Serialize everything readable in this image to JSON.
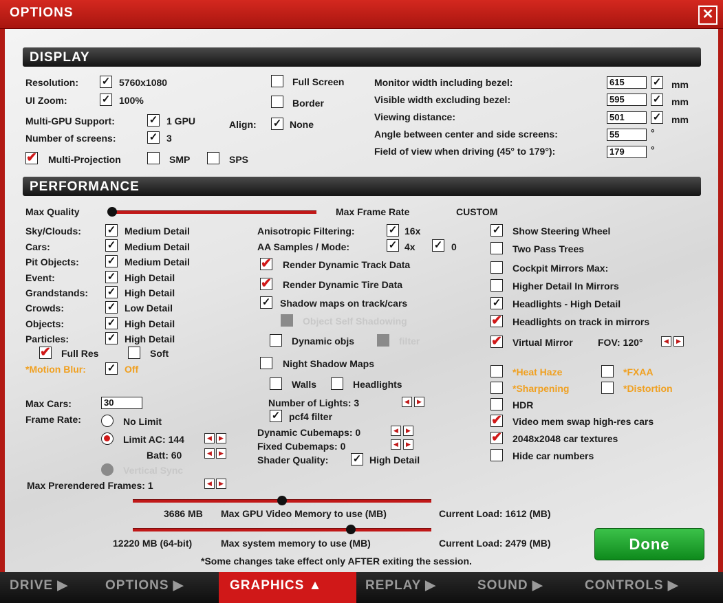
{
  "window": {
    "title": "OPTIONS",
    "close": "✕"
  },
  "display": {
    "header": "DISPLAY",
    "resolution_label": "Resolution:",
    "resolution_value": "5760x1080",
    "ui_zoom_label": "UI Zoom:",
    "ui_zoom_value": "100%",
    "multigpu_label": "Multi-GPU Support:",
    "multigpu_value": "1 GPU",
    "screens_label": "Number of screens:",
    "screens_value": "3",
    "multiprojection_label": "Multi-Projection",
    "smp_label": "SMP",
    "sps_label": "SPS",
    "fullscreen_label": "Full Screen",
    "border_label": "Border",
    "align_label": "Align:",
    "align_value": "None",
    "monitor_width_label": "Monitor width including bezel:",
    "monitor_width_value": "615",
    "visible_width_label": "Visible width excluding bezel:",
    "visible_width_value": "595",
    "viewing_distance_label": "Viewing distance:",
    "viewing_distance_value": "501",
    "unit_mm": "mm",
    "angle_label": "Angle between center and side screens:",
    "angle_value": "55",
    "fov_label": "Field of view when driving (45° to 179°):",
    "fov_value": "179",
    "degree": "°"
  },
  "performance": {
    "header": "PERFORMANCE",
    "max_quality_label": "Max Quality",
    "max_frame_rate_label": "Max Frame Rate",
    "preset_label": "CUSTOM",
    "quality_rows": [
      {
        "label": "Sky/Clouds:",
        "value": "Medium Detail"
      },
      {
        "label": "Cars:",
        "value": "Medium Detail"
      },
      {
        "label": "Pit Objects:",
        "value": "Medium Detail"
      },
      {
        "label": "Event:",
        "value": "High Detail"
      },
      {
        "label": "Grandstands:",
        "value": "High Detail"
      },
      {
        "label": "Crowds:",
        "value": "Low Detail"
      },
      {
        "label": "Objects:",
        "value": "High Detail"
      },
      {
        "label": "Particles:",
        "value": "High Detail"
      }
    ],
    "full_res_label": "Full Res",
    "soft_label": "Soft",
    "motion_blur_label": "*Motion Blur:",
    "motion_blur_value": "Off",
    "max_cars_label": "Max Cars:",
    "max_cars_value": "30",
    "frame_rate_label": "Frame Rate:",
    "no_limit_label": "No Limit",
    "limit_ac_label": "Limit AC: 144",
    "batt_label": "Batt: 60",
    "vsync_label": "Vertical Sync",
    "prerendered_label": "Max Prerendered Frames: 1",
    "aniso_label": "Anisotropic Filtering:",
    "aniso_value": "16x",
    "aa_label": "AA Samples / Mode:",
    "aa_value": "4x",
    "aa_mode": "0",
    "render_track_label": "Render Dynamic Track Data",
    "render_tire_label": "Render Dynamic Tire Data",
    "shadow_maps_label": "Shadow maps on track/cars",
    "self_shadow_label": "Object Self Shadowing",
    "dynamic_objs_label": "Dynamic objs",
    "filter_label": "filter",
    "night_shadow_label": "Night Shadow Maps",
    "walls_label": "Walls",
    "headlights_label": "Headlights",
    "num_lights_label": "Number of Lights: 3",
    "pcf4_label": "pcf4 filter",
    "dyn_cubemaps_label": "Dynamic Cubemaps: 0",
    "fixed_cubemaps_label": "Fixed Cubemaps: 0",
    "shader_quality_label": "Shader Quality:",
    "shader_quality_value": "High Detail",
    "show_wheel_label": "Show Steering Wheel",
    "two_pass_label": "Two Pass Trees",
    "cockpit_mirrors_label": "Cockpit Mirrors  Max:",
    "higher_detail_label": "Higher Detail In Mirrors",
    "headlights_hd_label": "Headlights - High Detail",
    "headlights_track_label": "Headlights on track in mirrors",
    "virtual_mirror_label": "Virtual Mirror",
    "fov_mirror_label": "FOV:  120°",
    "heat_haze_label": "*Heat Haze",
    "fxaa_label": "*FXAA",
    "sharpening_label": "*Sharpening",
    "distortion_label": "*Distortion",
    "hdr_label": "HDR",
    "video_swap_label": "Video mem swap high-res cars",
    "textures_label": "2048x2048 car textures",
    "hide_numbers_label": "Hide car numbers",
    "gpu_mem_value": "3686 MB",
    "gpu_mem_label": "Max GPU Video Memory to use (MB)",
    "gpu_load": "Current Load: 1612 (MB)",
    "sys_mem_value": "12220 MB (64-bit)",
    "sys_mem_label": "Max system memory to use (MB)",
    "sys_load": "Current Load: 2479 (MB)",
    "note": "*Some changes take effect only AFTER exiting the session.",
    "gpu_mem_fraction": 0.5,
    "sys_mem_fraction": 0.73
  },
  "done_label": "Done",
  "tabs": [
    {
      "label": "DRIVE ▶"
    },
    {
      "label": "OPTIONS ▶"
    },
    {
      "label": "GRAPHICS ▲"
    },
    {
      "label": "REPLAY ▶"
    },
    {
      "label": "SOUND ▶"
    },
    {
      "label": "CONTROLS ▶"
    }
  ],
  "glyphs": {
    "check": "✓",
    "red_check": "✔",
    "left": "◀",
    "right": "▶"
  },
  "colors": {
    "accent_red": "#d01818",
    "done_green": "#1ea02e",
    "warning_orange": "#f0a020"
  }
}
